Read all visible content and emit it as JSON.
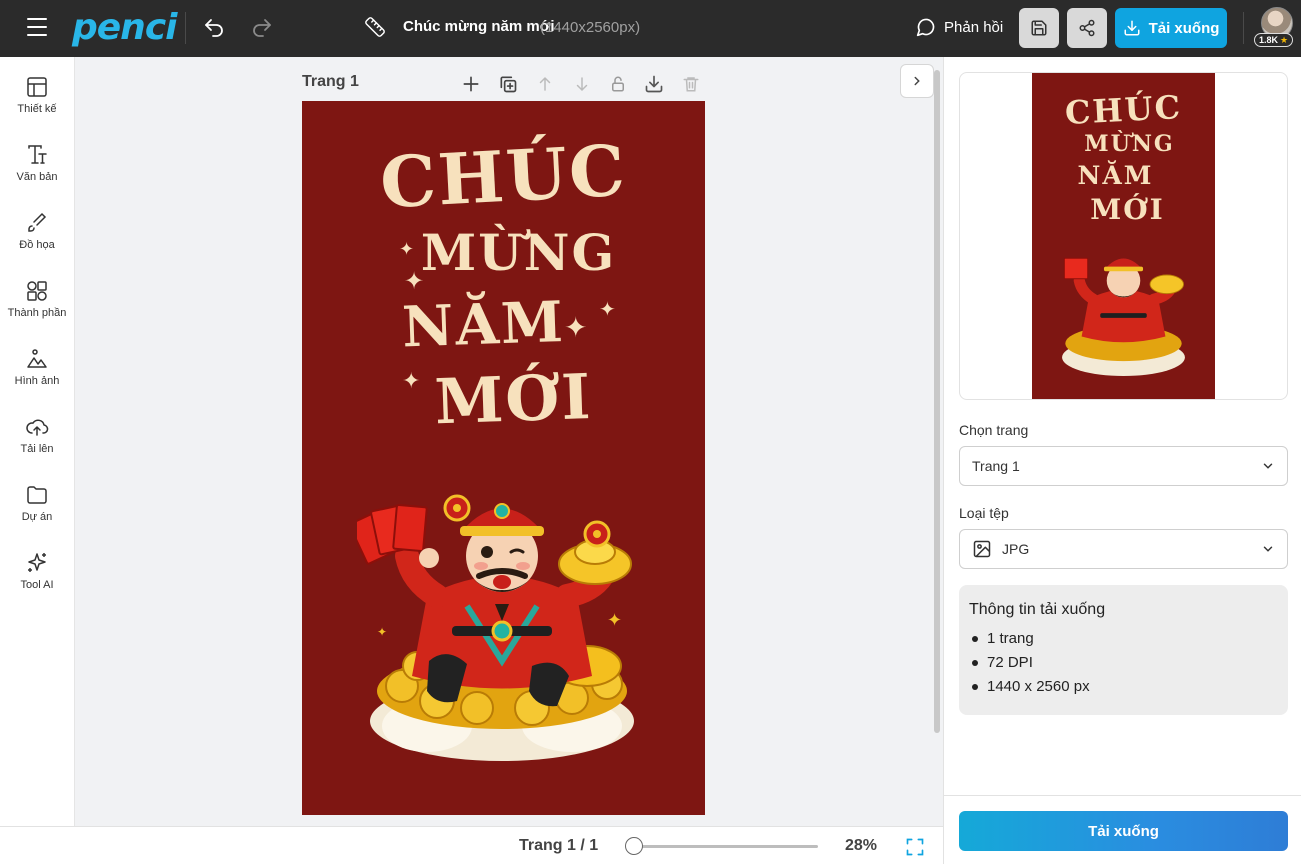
{
  "header": {
    "logo": "penci",
    "document_title": "Chúc mừng năm mới",
    "document_size": "(1440x2560px)",
    "feedback_label": "Phản hồi",
    "download_label": "Tải xuống",
    "user_points": "1.8K"
  },
  "sidebar": {
    "items": [
      {
        "label": "Thiết kế",
        "icon": "layout-icon"
      },
      {
        "label": "Văn bản",
        "icon": "text-icon"
      },
      {
        "label": "Đồ họa",
        "icon": "brush-icon"
      },
      {
        "label": "Thành phần",
        "icon": "shapes-icon"
      },
      {
        "label": "Hình ảnh",
        "icon": "image-icon"
      },
      {
        "label": "Tải lên",
        "icon": "upload-cloud-icon"
      },
      {
        "label": "Dự án",
        "icon": "folder-icon"
      },
      {
        "label": "Tool AI",
        "icon": "sparkles-icon"
      }
    ],
    "collapse_label": "»"
  },
  "canvas": {
    "page_label": "Trang 1",
    "poster": {
      "line1": "CHÚC",
      "line2": "MỪNG",
      "line3": "NĂM",
      "line4": "MỚI"
    }
  },
  "bottom_bar": {
    "page_indicator": "Trang 1 / 1",
    "zoom_percent": 28,
    "zoom_label": "28%"
  },
  "right_panel": {
    "select_page_label": "Chọn trang",
    "select_page_value": "Trang 1",
    "file_type_label": "Loại tệp",
    "file_type_value": "JPG",
    "info": {
      "title": "Thông tin tải xuống",
      "items": [
        "1 trang",
        "72 DPI",
        "1440 x 2560 px"
      ]
    },
    "download_button": "Tải xuống"
  },
  "colors": {
    "topbar": "#2b2b2b",
    "accent": "#0fa4e0",
    "poster_bg": "#7e1612",
    "poster_text": "#f7e1bd"
  }
}
